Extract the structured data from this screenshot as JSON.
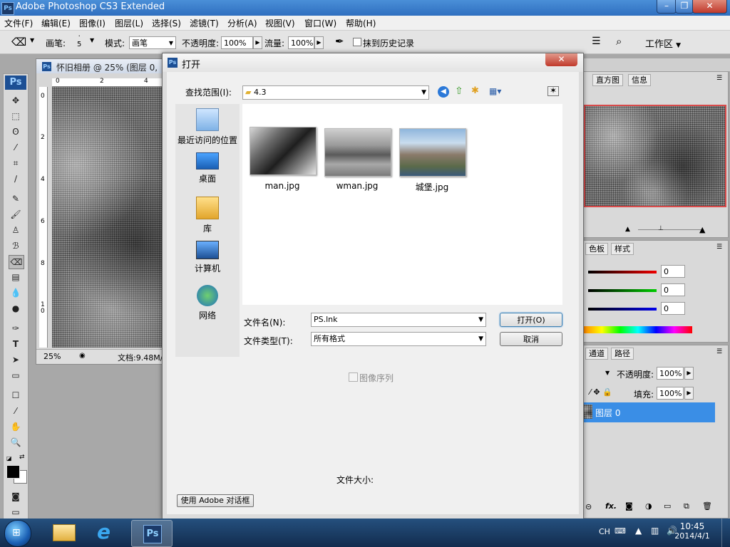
{
  "app": {
    "title": "Adobe Photoshop CS3 Extended",
    "logo": "Ps"
  },
  "window_buttons": {
    "minimize": "–",
    "restore": "❐",
    "close": "✕"
  },
  "menu": [
    "文件(F)",
    "编辑(E)",
    "图像(I)",
    "图层(L)",
    "选择(S)",
    "滤镜(T)",
    "分析(A)",
    "视图(V)",
    "窗口(W)",
    "帮助(H)"
  ],
  "options": {
    "brush_label": "画笔:",
    "brush_size": "5",
    "mode_label": "模式:",
    "mode_value": "画笔",
    "opacity_label": "不透明度:",
    "opacity_value": "100%",
    "flow_label": "流量:",
    "flow_value": "100%",
    "erase_history_label": "抹到历史记录",
    "workspace_label": "工作区"
  },
  "document": {
    "title": "怀旧相册 @ 25% (图层 0, ",
    "ruler_top": [
      "0",
      "2",
      "4"
    ],
    "ruler_left": [
      "0",
      "2",
      "4",
      "6",
      "8",
      "1\n0"
    ],
    "zoom": "25%",
    "doc_size": "文档:9.48M/"
  },
  "panels": {
    "navigator_tabs": [
      "直方图",
      "信息"
    ],
    "color_tabs": [
      "色板",
      "样式"
    ],
    "color_values": [
      "0",
      "0",
      "0"
    ],
    "layers_tabs": [
      "通道",
      "路径"
    ],
    "layers_opacity_label": "不透明度:",
    "layers_opacity": "100%",
    "fill_label": "填充:",
    "fill_value": "100%",
    "layer_name": "图层 0",
    "footer_fx": "fx."
  },
  "dialog": {
    "logo": "Ps",
    "title": "打开",
    "close": "✕",
    "look_in_label": "查找范围(I):",
    "look_in_value": "4.3",
    "places": [
      {
        "label": "最近访问的位置",
        "icon": "recent-places-icon"
      },
      {
        "label": "桌面",
        "icon": "desktop-icon"
      },
      {
        "label": "库",
        "icon": "libraries-icon"
      },
      {
        "label": "计算机",
        "icon": "computer-icon"
      },
      {
        "label": "网络",
        "icon": "network-icon"
      }
    ],
    "files": [
      {
        "name": "man.jpg"
      },
      {
        "name": "wman.jpg"
      },
      {
        "name": "城堡.jpg"
      }
    ],
    "filename_label": "文件名(N):",
    "filename_value": "PS.lnk",
    "filetype_label": "文件类型(T):",
    "filetype_value": "所有格式",
    "open_button": "打开(O)",
    "cancel_button": "取消",
    "image_sequence_label": "图像序列",
    "file_size_label": "文件大小:",
    "adobe_dialog_button": "使用 Adobe 对话框"
  },
  "taskbar": {
    "lang": "CH",
    "time": "10:45",
    "date": "2014/4/1",
    "ps_label": "Ps"
  },
  "colors": {
    "selection": "#3a8ee6",
    "titlebar": "#2f6fbf",
    "taskbar": "#1a3a63"
  }
}
